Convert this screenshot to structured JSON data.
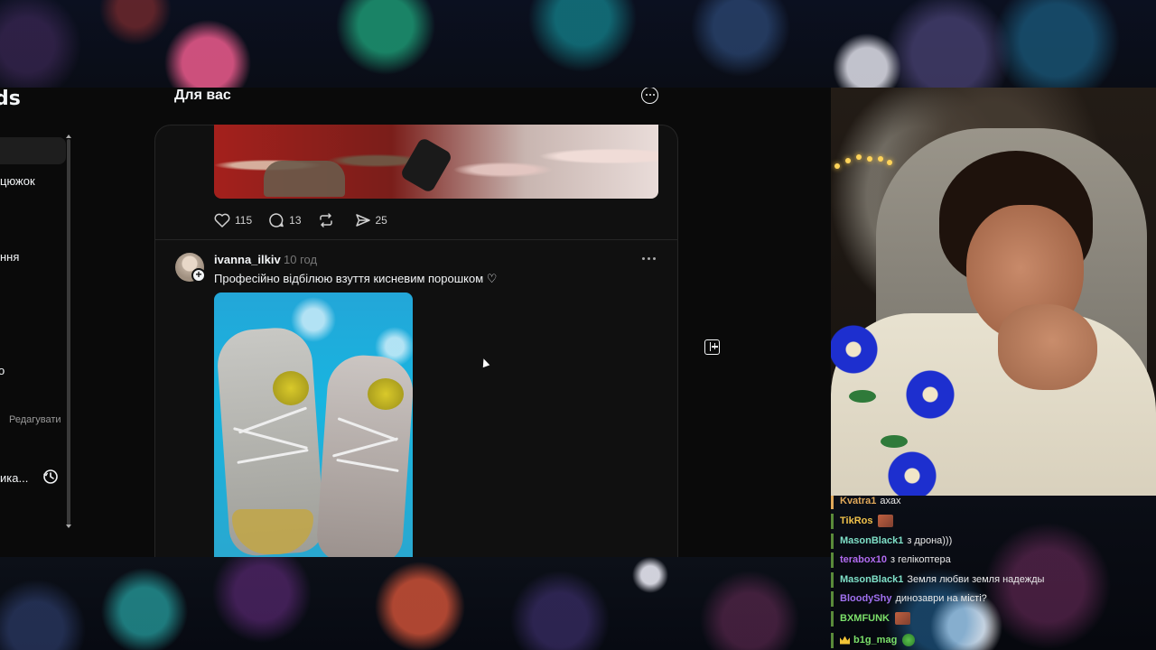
{
  "threads": {
    "logo_fragment": "ds",
    "feed_title": "Для вас",
    "sidebar": {
      "items": [
        {
          "label": ""
        },
        {
          "label": "цюжок"
        },
        {
          "label": "ння"
        },
        {
          "label": "о"
        },
        {
          "label": "ика..."
        }
      ],
      "edit_label": "Редагувати"
    },
    "prev_post": {
      "likes": "115",
      "comments": "13",
      "shares": "25"
    },
    "post": {
      "username": "ivanna_ilkiv",
      "time": "10 год",
      "text": "Професійно відбілюю взуття кисневим порошком ♡"
    }
  },
  "chat": {
    "messages": [
      {
        "user": "Kvatra1",
        "color": "#e0a85a",
        "bar": "#e0a85a",
        "text": "ахах",
        "emote": ""
      },
      {
        "user": "TikRos",
        "color": "#f0c24a",
        "bar": "#5a8a3a",
        "text": "",
        "emote": "emote"
      },
      {
        "user": "MasonBlack1",
        "color": "#7fe0c8",
        "bar": "#5a8a3a",
        "text": "з дрона)))",
        "emote": ""
      },
      {
        "user": "terabox10",
        "color": "#b06bf0",
        "bar": "#5a8a3a",
        "text": "з гелікоптера",
        "emote": ""
      },
      {
        "user": "MasonBlack1",
        "color": "#7fe0c8",
        "bar": "#5a8a3a",
        "text": "Земля любви земля надежды",
        "emote": ""
      },
      {
        "user": "BloodyShy",
        "color": "#a070f0",
        "bar": "#5a8a3a",
        "text": "динозаври на місті?",
        "emote": ""
      },
      {
        "user": "BXMFUNK",
        "color": "#7be06a",
        "bar": "#5a8a3a",
        "text": "",
        "emote": "emote"
      },
      {
        "user": "b1g_mag",
        "color": "#7be06a",
        "bar": "#5a8a3a",
        "text": "",
        "emote": "dino"
      }
    ]
  }
}
